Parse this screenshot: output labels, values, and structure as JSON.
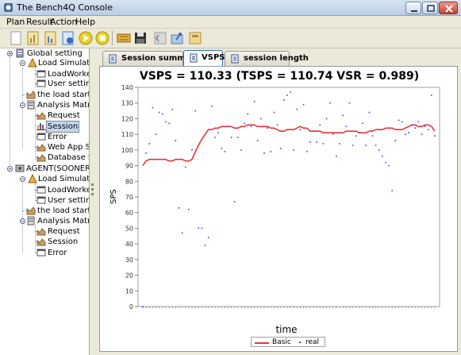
{
  "window": {
    "title": "The Bench4Q Console"
  },
  "menu": [
    "Plan",
    "Result",
    "Action",
    "Help"
  ],
  "toolbar": {
    "buttons": [
      "new-plan-icon",
      "chart-icon",
      "report-icon",
      "run-icon",
      "play-icon",
      "stop-icon",
      "agent-icon",
      "save-icon",
      "back-icon",
      "export-icon",
      "config-icon"
    ]
  },
  "tree": {
    "global_setting": "Global setting",
    "load_simulator": "Load Simulator",
    "load_worker": "LoadWorker",
    "user_setting": "User setting",
    "load_started": "the load started",
    "analysis_matrix": "Analysis Matrix",
    "request": "Request",
    "session": "Session",
    "error": "Error",
    "web_app_server": "Web App Serve",
    "database_server": "Database Serv",
    "agent": "AGENT(SOONER)",
    "agent_load_simulator": "Load Simulator",
    "agent_load_worker": "LoadWorker",
    "agent_user_setting": "User setting",
    "agent_load_started": "the load started",
    "agent_analysis_matrix": "Analysis Matrix",
    "agent_request": "Request",
    "agent_session": "Session",
    "agent_error": "Error"
  },
  "tabs": [
    "Session summarize",
    "VSPS",
    "session length"
  ],
  "active_tab": "VSPS",
  "chart_data": {
    "type": "line",
    "title": "VSPS = 110.33 (TSPS = 110.74 VSR = 0.989)",
    "xlabel": "time",
    "ylabel": "SPS",
    "ylim": [
      0,
      140
    ],
    "yticks": [
      0,
      10,
      20,
      30,
      40,
      50,
      60,
      70,
      80,
      90,
      100,
      110,
      120,
      130,
      140
    ],
    "legend": [
      "Basic",
      "real"
    ],
    "legend_placement": "bottom-center",
    "colors": {
      "Basic": "#e8323c",
      "real": "#3348e0"
    },
    "x": [
      0,
      1,
      2,
      3,
      4,
      5,
      6,
      7,
      8,
      9,
      10,
      11,
      12,
      13,
      14,
      15,
      16,
      17,
      18,
      19,
      20,
      21,
      22,
      23,
      24,
      25,
      26,
      27,
      28,
      29,
      30,
      31,
      32,
      33,
      34,
      35,
      36,
      37,
      38,
      39,
      40,
      41,
      42,
      43,
      44,
      45,
      46,
      47,
      48,
      49,
      50,
      51,
      52,
      53,
      54,
      55,
      56,
      57,
      58,
      59,
      60,
      61,
      62,
      63,
      64,
      65,
      66,
      67,
      68,
      69,
      70,
      71,
      72,
      73,
      74,
      75,
      76,
      77,
      78,
      79,
      80,
      81,
      82,
      83,
      84,
      85,
      86,
      87,
      88,
      89
    ],
    "series": [
      {
        "name": "Basic",
        "values": [
          90,
          93,
          94,
          94,
          94,
          94,
          94,
          94,
          93,
          93,
          94,
          94,
          94,
          93,
          93,
          94,
          99,
          103,
          107,
          110,
          113,
          113,
          114,
          114,
          115,
          115,
          115,
          115,
          114,
          114,
          115,
          115,
          116,
          116,
          116,
          115,
          115,
          115,
          115,
          114,
          114,
          113,
          112,
          112,
          113,
          113,
          113,
          114,
          115,
          114,
          114,
          112,
          112,
          112,
          112,
          111,
          111,
          111,
          111,
          111,
          111,
          111,
          112,
          112,
          112,
          112,
          111,
          111,
          111,
          112,
          112,
          113,
          113,
          113,
          114,
          114,
          114,
          113,
          113,
          113,
          114,
          115,
          116,
          116,
          115,
          115,
          116,
          116,
          115,
          112
        ]
      },
      {
        "name": "real",
        "values": [
          0,
          98,
          104,
          127,
          110,
          124,
          123,
          118,
          117,
          126,
          106,
          63,
          47,
          89,
          62,
          100,
          125,
          50,
          50,
          39,
          44,
          128,
          108,
          111,
          101,
          99,
          115,
          108,
          67,
          108,
          100,
          117,
          123,
          115,
          131,
          106,
          120,
          98,
          114,
          99,
          124,
          116,
          101,
          132,
          135,
          137,
          100,
          126,
          113,
          129,
          99,
          105,
          112,
          105,
          116,
          104,
          120,
          130,
          110,
          96,
          104,
          122,
          115,
          130,
          103,
          109,
          111,
          117,
          103,
          124,
          109,
          103,
          100,
          96,
          92,
          90,
          74,
          106,
          119,
          118,
          110,
          111,
          116,
          114,
          118,
          110,
          115,
          113,
          135,
          109
        ]
      }
    ]
  }
}
